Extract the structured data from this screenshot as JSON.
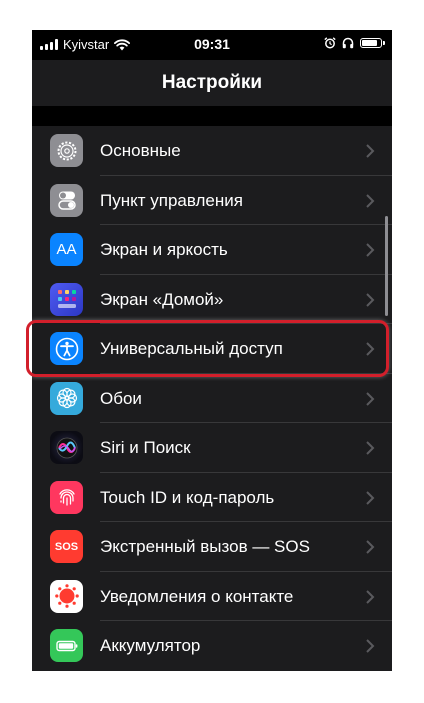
{
  "status_bar": {
    "carrier": "Kyivstar",
    "time": "09:31"
  },
  "nav": {
    "title": "Настройки"
  },
  "colors": {
    "background": "#1c1c1e",
    "highlight": "#d21f2b"
  },
  "settings": [
    {
      "label": "Основные",
      "icon": "gear-icon",
      "color": "#8e8e93"
    },
    {
      "label": "Пункт управления",
      "icon": "toggle-switches-icon",
      "color": "#8e8e93"
    },
    {
      "label": "Экран и яркость",
      "icon": "text-size-aa-icon",
      "color": "#0a84ff"
    },
    {
      "label": "Экран «Домой»",
      "icon": "home-screen-grid-icon",
      "color": "#3a4ae0"
    },
    {
      "label": "Универсальный доступ",
      "icon": "accessibility-person-icon",
      "color": "#0a84ff"
    },
    {
      "label": "Обои",
      "icon": "flower-icon",
      "color": "#35aadc"
    },
    {
      "label": "Siri и Поиск",
      "icon": "siri-orb-icon",
      "color": "#202030"
    },
    {
      "label": "Touch ID и код-пароль",
      "icon": "fingerprint-icon",
      "color": "#ff375f"
    },
    {
      "label": "Экстренный вызов — SOS",
      "icon": "sos-icon",
      "color": "#ff3b30"
    },
    {
      "label": "Уведомления о контакте",
      "icon": "exposure-notification-icon",
      "color": "#ffffff"
    },
    {
      "label": "Аккумулятор",
      "icon": "battery-icon",
      "color": "#34c759"
    }
  ],
  "icons": {
    "display_text": "AA",
    "sos_text": "SOS"
  }
}
